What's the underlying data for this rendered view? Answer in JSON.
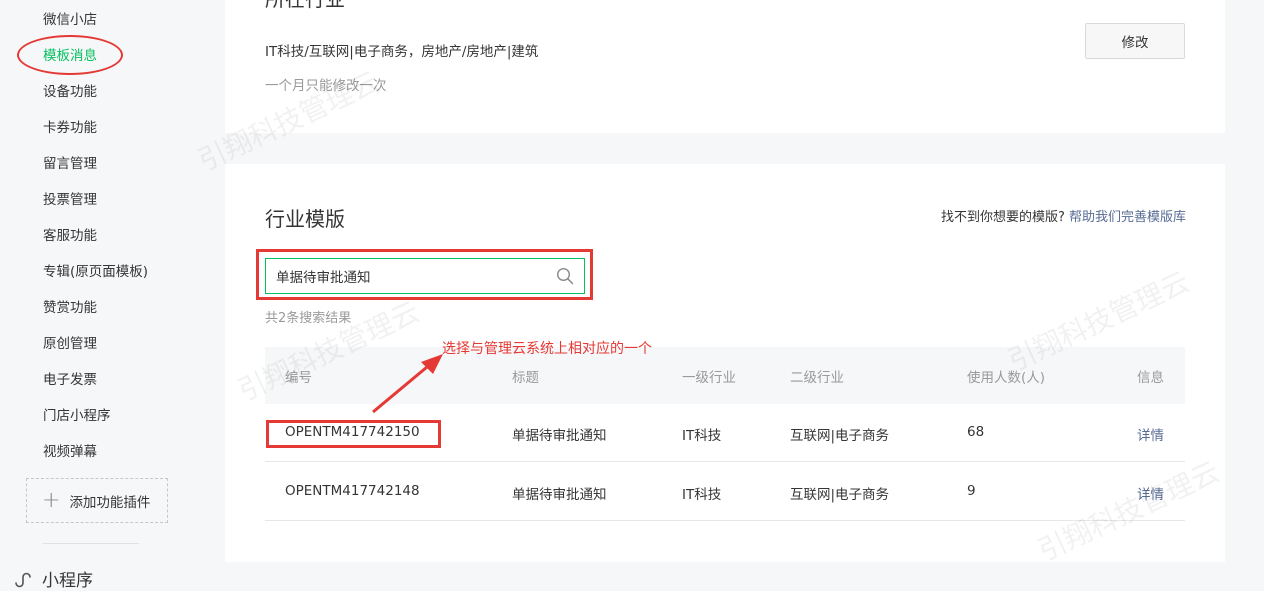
{
  "sidebar": {
    "items": [
      {
        "label": "微信小店"
      },
      {
        "label": "模板消息"
      },
      {
        "label": "设备功能"
      },
      {
        "label": "卡券功能"
      },
      {
        "label": "留言管理"
      },
      {
        "label": "投票管理"
      },
      {
        "label": "客服功能"
      },
      {
        "label": "专辑(原页面模板)"
      },
      {
        "label": "赞赏功能"
      },
      {
        "label": "原创管理"
      },
      {
        "label": "电子发票"
      },
      {
        "label": "门店小程序"
      },
      {
        "label": "视频弹幕"
      }
    ],
    "active_label": "模板消息",
    "add_plugin_label": "添加功能插件",
    "miniapp_label": "小程序"
  },
  "industry": {
    "title": "所在行业",
    "value": "IT科技/互联网|电子商务，房地产/房地产|建筑",
    "hint": "一个月只能修改一次",
    "modify_label": "修改"
  },
  "templates": {
    "title": "行业模版",
    "help_prefix": "找不到你想要的模版?",
    "help_link": "帮助我们完善模版库",
    "search_value": "单据待审批通知",
    "result_count": "共2条搜索结果",
    "annotation": "选择与管理云系统上相对应的一个",
    "columns": [
      "编号",
      "标题",
      "一级行业",
      "二级行业",
      "使用人数(人)",
      "信息"
    ],
    "rows": [
      {
        "id": "OPENTM417742150",
        "title": "单据待审批通知",
        "primary": "IT科技",
        "secondary": "互联网|电子商务",
        "users": "68",
        "info": "详情"
      },
      {
        "id": "OPENTM417742148",
        "title": "单据待审批通知",
        "primary": "IT科技",
        "secondary": "互联网|电子商务",
        "users": "9",
        "info": "详情"
      }
    ]
  },
  "watermark": "引翔科技管理云",
  "colors": {
    "accent_green": "#07c160",
    "link_blue": "#576b95",
    "annotation_red": "#e53935"
  }
}
